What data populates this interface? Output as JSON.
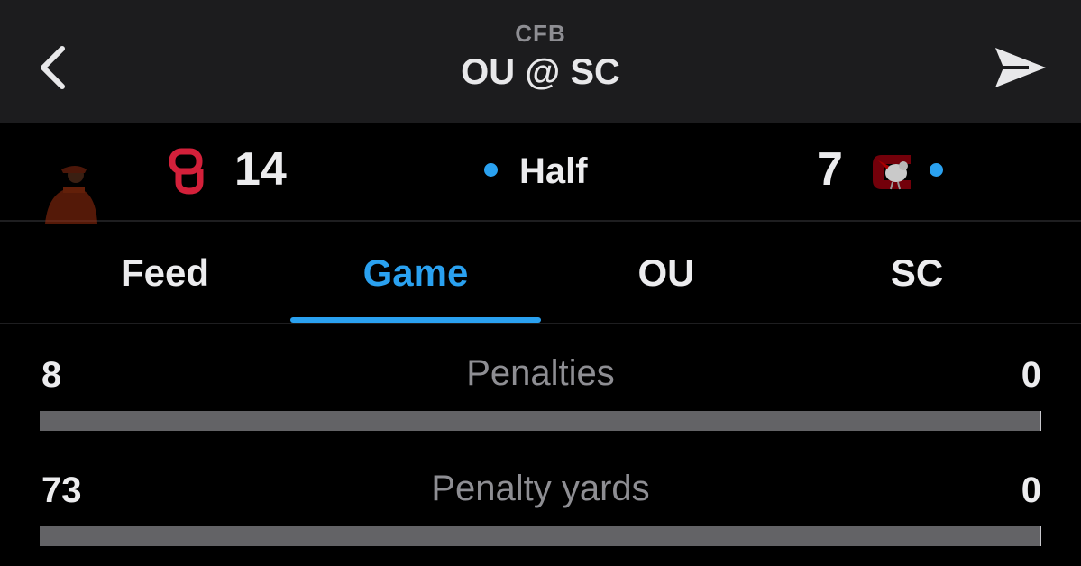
{
  "header": {
    "league": "CFB",
    "matchup": "OU @ SC",
    "back_icon": "chevron-left-icon",
    "share_icon": "paper-plane-icon"
  },
  "scoreboard": {
    "away": {
      "abbr": "OU",
      "score": "14",
      "color": "#d3203a"
    },
    "home": {
      "abbr": "SC",
      "score": "7",
      "color": "#73000a",
      "possession": true
    },
    "period": "Half",
    "live_color": "#2aa1f0"
  },
  "tabs": [
    {
      "label": "Feed",
      "active": false
    },
    {
      "label": "Game",
      "active": true
    },
    {
      "label": "OU",
      "active": false
    },
    {
      "label": "SC",
      "active": false
    }
  ],
  "stats": [
    {
      "label": "Penalties",
      "away": "8",
      "home": "0",
      "home_share": 0
    },
    {
      "label": "Penalty yards",
      "away": "73",
      "home": "0",
      "home_share": 0
    }
  ],
  "colors": {
    "accent": "#2aa1f0",
    "header_bg": "#1c1c1e",
    "muted_text": "#8e8e93",
    "bar_away": "#636366"
  }
}
